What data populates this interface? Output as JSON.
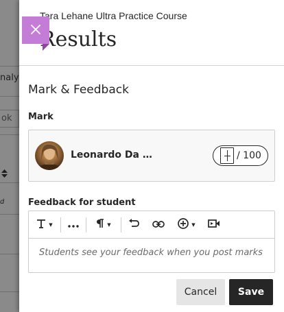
{
  "background": {
    "tab_fragment": "nalys",
    "box_fragment": "ok",
    "sort_icon": "sort-arrows-icon",
    "italic_fragment": "d"
  },
  "panel": {
    "course_name": "Tara Lehane Ultra Practice Course",
    "title": "Results",
    "close_icon": "close-icon",
    "accent_color": "#c47dd6"
  },
  "mark_feedback": {
    "section_title": "Mark & Feedback",
    "mark_label": "Mark",
    "student": {
      "name": "Leonardo Da Vi...",
      "avatar": "avatar"
    },
    "grade": {
      "value": "",
      "total": "/ 100"
    }
  },
  "feedback": {
    "label": "Feedback for student",
    "toolbar": [
      {
        "name": "text-format-icon",
        "glyph": "T",
        "caret": true
      },
      {
        "name": "more-icon",
        "glyph": "•••",
        "caret": false
      },
      {
        "name": "paragraph-icon",
        "glyph": "¶",
        "caret": true
      },
      {
        "name": "undo-icon",
        "glyph": "↶",
        "caret": false
      },
      {
        "name": "link-icon",
        "glyph": "⛓",
        "caret": false
      },
      {
        "name": "insert-content-icon",
        "glyph": "⊕",
        "caret": true
      },
      {
        "name": "media-icon",
        "glyph": "▣",
        "caret": false
      }
    ],
    "placeholder": "Students see your feedback when you post marks"
  },
  "actions": {
    "cancel_label": "Cancel",
    "save_label": "Save"
  }
}
